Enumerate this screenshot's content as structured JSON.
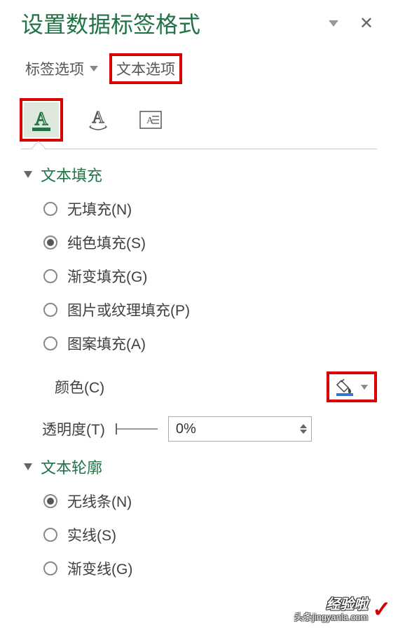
{
  "panel": {
    "title": "设置数据标签格式"
  },
  "tabs": {
    "label_options": "标签选项",
    "text_options": "文本选项"
  },
  "sections": {
    "text_fill": {
      "title": "文本填充",
      "options": {
        "no_fill": "无填充(N)",
        "solid_fill": "纯色填充(S)",
        "gradient_fill": "渐变填充(G)",
        "picture_fill": "图片或纹理填充(P)",
        "pattern_fill": "图案填充(A)"
      },
      "color_label": "颜色(C)",
      "transparency_label": "透明度(T)",
      "transparency_value": "0%"
    },
    "text_outline": {
      "title": "文本轮廓",
      "options": {
        "no_line": "无线条(N)",
        "solid_line": "实线(S)",
        "gradient_line": "渐变线(G)"
      }
    }
  },
  "watermark": {
    "line1": "经验啦",
    "line2": "头条jingyanla.com"
  }
}
